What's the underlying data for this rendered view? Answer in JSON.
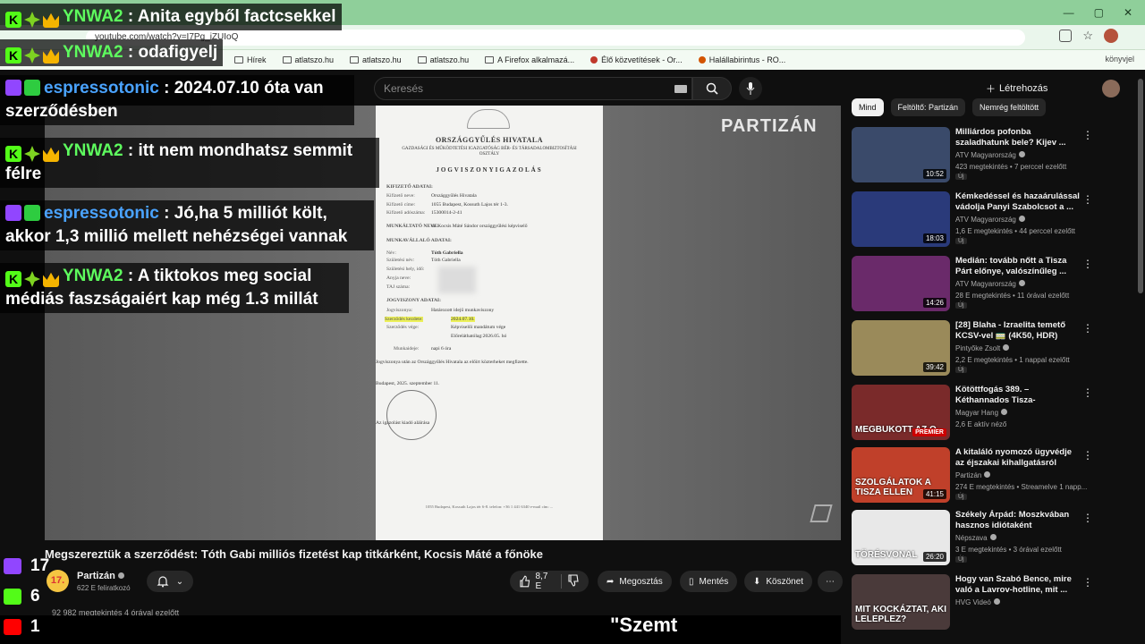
{
  "browser": {
    "url": "youtube.com/watch?v=I7Pg_iZUIoQ",
    "bookmarks": [
      "Hírek",
      "atlatszo.hu",
      "atlatszo.hu",
      "atlatszo.hu",
      "A Firefox alkalmazá...",
      "Élő közvetítések - Or...",
      "Halállabirintus - RO..."
    ],
    "bookmarks_right": "könyvjel"
  },
  "youtube": {
    "search_placeholder": "Keresés",
    "create_label": "Létrehozás"
  },
  "chat": [
    {
      "user": "YNWA2",
      "platform": "kick",
      "text": ": Anita egyből factcsekkel",
      "wrap": ""
    },
    {
      "user": "YNWA2",
      "platform": "kick",
      "text": ": odafigyelj",
      "wrap": ""
    },
    {
      "user": "espressotonic",
      "platform": "twitch",
      "text": ": 2024.07.10 óta van",
      "wrap": "szerződésben"
    },
    {
      "user": "YNWA2",
      "platform": "kick",
      "text": ": itt nem mondhatsz semmit",
      "wrap": "félre"
    },
    {
      "user": "espressotonic",
      "platform": "twitch",
      "text": ": Jó,ha 5 milliót költ,",
      "wrap": "akkor 1,3 millió mellett nehézségei vannak"
    },
    {
      "user": "YNWA2",
      "platform": "kick",
      "text": ": A tiktokos meg social",
      "wrap": "médiás faszságaiért kap még 1.3 millát"
    }
  ],
  "counters": {
    "twitch": "17",
    "kick": "6",
    "youtube": "1"
  },
  "document": {
    "heading": "ORSZÁGGYŰLÉS HIVATALA",
    "subheading": "GAZDASÁGI ÉS MŰKÖDTETÉSI IGAZGATÓSÁG BÉR- ÉS TÁRSADALOMBIZTOSÍTÁSI OSZTÁLY",
    "title": "JOGVISZONYIGAZOLÁS",
    "section_employer": "KIFIZETŐ ADATAI:",
    "employer_name_label": "Kifizető neve:",
    "employer_name": "Országgyűlés Hivatala",
    "employer_addr_label": "Kifizető címe:",
    "employer_addr": "1055 Budapest, Kossuth Lajos tér 1-3.",
    "employer_tax_label": "Kifizető adószáma:",
    "employer_tax": "15300014-2-41",
    "employer_boss_label": "MUNKÁLTATÓ NEVE:",
    "employer_boss": "dr. Kocsis Máté Sándor országgyűlési képviselő",
    "section_employee": "MUNKAVÁLLALÓ ADATAI:",
    "name_label": "Név:",
    "name": "Tóth Gabriella",
    "birthname_label": "Születési név:",
    "birthname": "Tóth Gabriella",
    "birthplace_label": "Születési hely, idő:",
    "mother_label": "Anyja neve:",
    "taj_label": "TAJ száma:",
    "section_contract": "JOGVISZONY ADATAI:",
    "type_label": "Jogviszonya:",
    "type": "Határozott idejű munkaviszony",
    "start_label": "Szerződés kezdete:",
    "start": "2024.07.10.",
    "end_label": "Szerződés vége:",
    "end": "Képviselői mandátum vége",
    "end_note": "Előreláthatólag:2026.05. hó",
    "hours_label": "Munkaideje:",
    "hours": "napi 6 óra",
    "note": "Jogviszonya után az Országgyűlés Hivatala az előírt közterheket megfizette.",
    "place_date": "Budapest, 2025. szeptember 11.",
    "signature": "Az igazolást kiadó aláírása",
    "footer": "1055 Budapest, Kossuth Lajos tér 6-8. telefon: +36 1 441 6340 e-mail cím: ..."
  },
  "player": {
    "watermark": "PARTIZÁN"
  },
  "video": {
    "title": "Megszereztük a szerződést: Tóth Gabi milliós fizetést kap titkárként, Kocsis Máté a főnöke",
    "channel": "Partizán",
    "channel_logo": "17.",
    "subscribers": "622 E feliratkozó",
    "likes": "8,7 E",
    "share": "Megosztás",
    "save": "Mentés",
    "thanks": "Köszönet",
    "views": "92 982 megtekintés  4 órával ezelőtt",
    "subtitle": "\"Szemt"
  },
  "chips": [
    "Mind",
    "Feltöltő: Partizán",
    "Nemrég feltöltött"
  ],
  "recommendations": [
    {
      "title": "Milliárdos pofonba szaladhatunk bele? Kijev ...",
      "channel": "ATV Magyarország",
      "meta": "423 megtekintés • 7 perccel ezelőtt",
      "badge": "Új",
      "duration": "10:52",
      "color": "#3a4a6a",
      "thumb_text": ""
    },
    {
      "title": "Kémkedéssel és hazaárulással vádolja Panyi Szabolcsot a ...",
      "channel": "ATV Magyarország",
      "meta": "1,6 E megtekintés • 44 perccel ezelőtt",
      "badge": "Új",
      "duration": "18:03",
      "color": "#2a3a7a",
      "thumb_text": ""
    },
    {
      "title": "Medián: tovább nőtt a Tisza Párt előnye, valószínűleg ...",
      "channel": "ATV Magyarország",
      "meta": "28 E megtekintés • 11 órával ezelőtt",
      "badge": "Új",
      "duration": "14:26",
      "color": "#6a2a6a",
      "thumb_text": ""
    },
    {
      "title": "[28] Blaha - Izraelita temető KCSV-vel 🚃 (4K50, HDR)",
      "channel": "Pintyőke Zsolt",
      "meta": "2,2 E megtekintés • 1 nappal ezelőtt",
      "badge": "Új",
      "duration": "39:42",
      "color": "#9a8a5a",
      "thumb_text": ""
    },
    {
      "title": "Kötöttfogás 389. – Kéthannados Tisza-győzelme...",
      "channel": "Magyar Hang",
      "meta": "2,6 E aktív néző",
      "badge": "",
      "duration": "PREMIER",
      "color": "#7a2a2a",
      "thumb_text": "MEGBUKOTT AZ O"
    },
    {
      "title": "A kitaláló nyomozó ügyvédje az éjszakai kihallgatásról",
      "channel": "Partizán",
      "meta": "274 E megtekintés • Streamelve 1 napp...",
      "badge": "Új",
      "duration": "41:15",
      "color": "#c0402a",
      "thumb_text": "SZOLGÁLATOK A TISZA ELLEN"
    },
    {
      "title": "Székely Árpád: Moszkvában hasznos idiótaként tekintenek...",
      "channel": "Népszava",
      "meta": "3 E megtekintés • 3 órával ezelőtt",
      "badge": "Új",
      "duration": "26:20",
      "color": "#e8e8e8",
      "thumb_text": "TÖRÉSVONAL"
    },
    {
      "title": "Hogy van Szabó Bence, mire való a Lavrov-hotline, mit ...",
      "channel": "HVG Videó",
      "meta": "",
      "badge": "",
      "duration": "",
      "color": "#4a3a3a",
      "thumb_text": "MIT KOCKÁZTAT, AKI LELEPLEZ?"
    }
  ]
}
